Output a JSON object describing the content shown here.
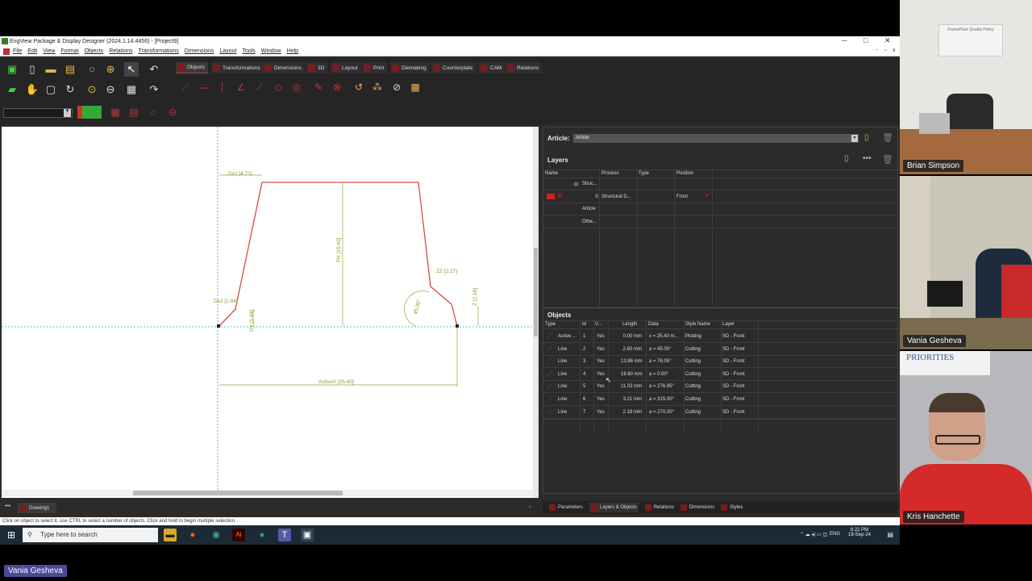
{
  "window": {
    "title": "EngView Package & Display Designer (2024.1.14.4456) - [Project9]",
    "controls": [
      "─",
      "□",
      "✕"
    ],
    "mdi_controls": [
      "-",
      "▫",
      "x"
    ]
  },
  "menu": [
    "File",
    "Edit",
    "View",
    "Format",
    "Objects",
    "Relations",
    "Transformations",
    "Dimensions",
    "Layout",
    "Tools",
    "Window",
    "Help"
  ],
  "tabs": [
    "Objects",
    "Transformations",
    "Dimensions",
    "3D",
    "Layout",
    "Print",
    "Diemaking",
    "Counterplate",
    "CAM",
    "Relations"
  ],
  "canvas": {
    "dims": {
      "dx1": "Dx1 [4.71]",
      "fh": "FH [15.40]",
      "dx2": "Dx2 [1.84]",
      "dy": "DY [1.84]",
      "zz": "ZZ [2.27]",
      "angle": "45.00°",
      "z": "Z [2.18]",
      "activex": "ActiveX [25.40]"
    }
  },
  "panel": {
    "article_label": "Article:",
    "article_value": "Article",
    "layers_title": "Layers",
    "layers_columns": [
      "Name",
      "Process",
      "Type",
      "Position"
    ],
    "layers_tree": {
      "struc": "Struc...",
      "s": "S",
      "process": "Structural D...",
      "position": "Front",
      "article": "Article",
      "other": "Othe..."
    },
    "objects_title": "Objects",
    "objects_columns": [
      "Type",
      "Id",
      "V...",
      "Length",
      "Data",
      "Style Name",
      "Layer"
    ],
    "objects_rows": [
      {
        "type": "Active ...",
        "id": "1",
        "v": "Yes",
        "length": "0.00 mm",
        "data": "x = 25.40 m...",
        "style": "Plotting",
        "layer": "SD - Front"
      },
      {
        "type": "Line",
        "id": "2",
        "v": "Yes",
        "length": "2.60 mm",
        "data": "a = 45.00°",
        "style": "Cutting",
        "layer": "SD - Front"
      },
      {
        "type": "Line",
        "id": "3",
        "v": "Yes",
        "length": "13.86 mm",
        "data": "a = 78.05°",
        "style": "Cutting",
        "layer": "SD - Front"
      },
      {
        "type": "Line",
        "id": "4",
        "v": "Yes",
        "length": "16.60 mm",
        "data": "a = 0.00°",
        "style": "Cutting",
        "layer": "SD - Front"
      },
      {
        "type": "Line",
        "id": "5",
        "v": "Yes",
        "length": "11.03 mm",
        "data": "a = 276.85°",
        "style": "Cutting",
        "layer": "SD - Front"
      },
      {
        "type": "Line",
        "id": "6",
        "v": "Yes",
        "length": "3.21 mm",
        "data": "a = 315.00°",
        "style": "Cutting",
        "layer": "SD - Front"
      },
      {
        "type": "Line",
        "id": "7",
        "v": "Yes",
        "length": "2.18 mm",
        "data": "a = 270.00°",
        "style": "Cutting",
        "layer": "SD - Front"
      }
    ]
  },
  "bottom_tabs": [
    "Parameters",
    "Layers & Objects",
    "Relations",
    "Dimensions",
    "Styles"
  ],
  "drawing_tab": "Drawing1",
  "status": "Click on object to select it, use CTRL to select a number of objects. Click and hold to begin multiple selection.",
  "taskbar": {
    "search_placeholder": "Type here to search",
    "lang": "ENG",
    "time": "6:22 PM",
    "date": "19-Sep-24"
  },
  "participants": [
    "Brian Simpson",
    "Vania Gesheva",
    "Kris Hanchette"
  ],
  "room_sign": "PRIORITIES",
  "wall_sign": "FramePack Quality Policy",
  "speaker_label": "Vania Gesheva",
  "colors": {
    "accent": "#c8202f",
    "dim_green": "#8a9a2a",
    "canvas_bg": "#ffffff",
    "panel_bg": "#2b2b2b"
  }
}
